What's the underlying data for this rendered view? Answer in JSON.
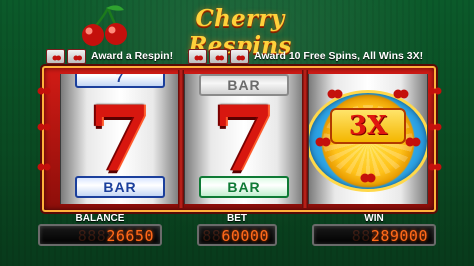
{
  "header": {
    "title": "Cherry Respins",
    "cherry_icon": "cherry-pair-icon"
  },
  "award_bar": {
    "left_text": "Award a Respin!",
    "right_text": "Award 10 Free Spins, All Wins 3X!",
    "left_icons": 2,
    "right_icons": 3
  },
  "reels": [
    {
      "top": "7",
      "middle": "7",
      "bottom": "BAR"
    },
    {
      "top": "BAR",
      "middle": "7",
      "bottom": "BAR"
    },
    {
      "middle": "3X"
    }
  ],
  "meters": {
    "balance": {
      "label": "BALANCE",
      "value": "26650",
      "ghost": "88888888"
    },
    "bet": {
      "label": "BET",
      "value": "60000",
      "ghost": "8888888"
    },
    "win": {
      "label": "WIN",
      "value": "289000",
      "ghost": "88888888"
    }
  },
  "colors": {
    "accent_gold": "#ffd23b",
    "frame_red": "#d11b15",
    "meter_led": "#ff6a1a",
    "felt_green": "#0a4a22"
  }
}
